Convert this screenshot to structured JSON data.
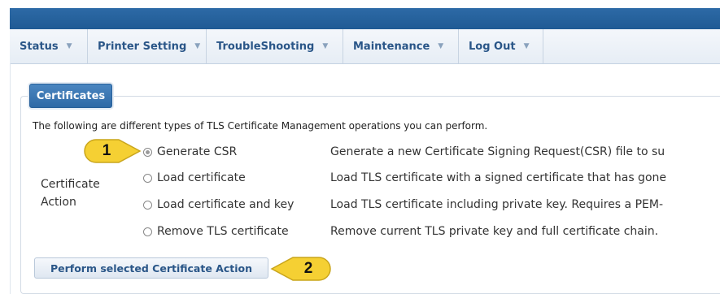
{
  "nav": {
    "items": [
      {
        "label": "Status"
      },
      {
        "label": "Printer Setting"
      },
      {
        "label": "TroubleShooting"
      },
      {
        "label": "Maintenance"
      },
      {
        "label": "Log Out"
      }
    ],
    "caret": "▼"
  },
  "panel": {
    "tab_label": "Certificates",
    "intro": "The following are different types of TLS Certificate Management operations you can perform.",
    "field_label_line1": "Certificate",
    "field_label_line2": "Action",
    "options": [
      {
        "label": "Generate CSR",
        "checked": true,
        "description": "Generate a new Certificate Signing Request(CSR) file to su"
      },
      {
        "label": "Load certificate",
        "checked": false,
        "description": "Load TLS certificate with a signed certificate that has gone"
      },
      {
        "label": "Load certificate and key",
        "checked": false,
        "description": "Load TLS certificate including private key. Requires a PEM-"
      },
      {
        "label": "Remove TLS certificate",
        "checked": false,
        "description": "Remove current TLS private key and full certificate chain."
      }
    ],
    "perform_button": "Perform selected Certificate Action"
  },
  "callouts": {
    "one": "1",
    "two": "2",
    "color": "#f5d033"
  },
  "colors": {
    "header_blue": "#1f5a94",
    "nav_text": "#2a5688",
    "tab_blue": "#2f6aa6"
  }
}
